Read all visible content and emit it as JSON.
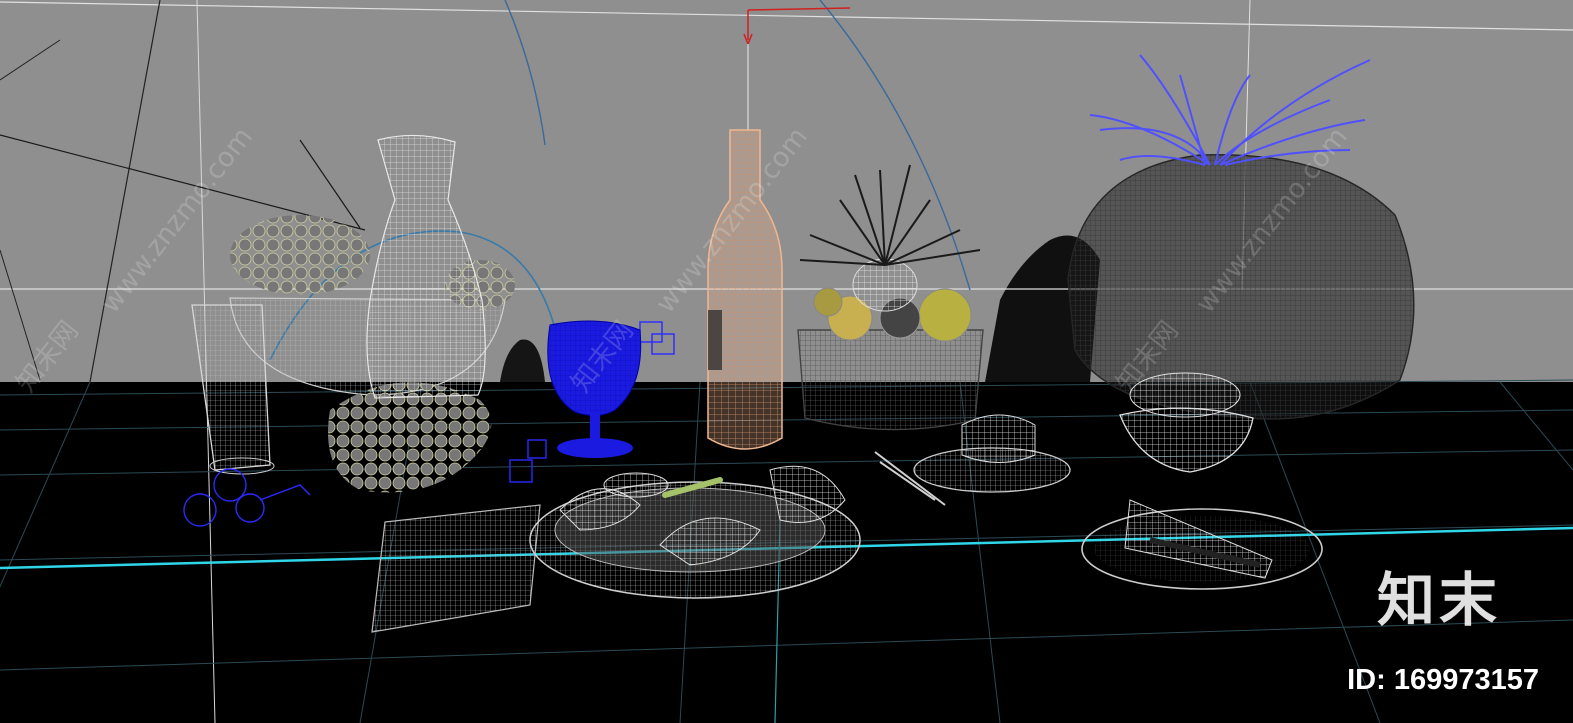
{
  "viewport": {
    "background_top": "#8f8f8f",
    "background_floor": "#000000",
    "wire_white": "#e6e6e6",
    "wire_grey": "#a8a8a8",
    "wire_dark": "#3a3a3a",
    "selected_blue": "#1a1ae0",
    "bottle_peach": "#f0b890",
    "grass_blue": "#5050ff",
    "grid_cyan": "#2fd6e8",
    "gizmo_red": "#d02020"
  },
  "watermarks": {
    "site": "www.znzmo.com",
    "brand_cn": "知末网"
  },
  "branding": {
    "logo_text": "知末",
    "asset_id": "ID: 169973157"
  },
  "objects": [
    {
      "name": "carafe",
      "icon": "carafe-wireframe"
    },
    {
      "name": "grape-bowl",
      "icon": "bowl-wireframe"
    },
    {
      "name": "tall-glass",
      "icon": "glass-wireframe"
    },
    {
      "name": "brandy-glass",
      "icon": "snifter-selected"
    },
    {
      "name": "wine-bottle",
      "icon": "bottle-wireframe"
    },
    {
      "name": "fruit-basket",
      "icon": "basket-wireframe"
    },
    {
      "name": "wicker-pot",
      "icon": "pot-wireframe"
    },
    {
      "name": "grass-plant",
      "icon": "plant-selected"
    },
    {
      "name": "cake-plate",
      "icon": "plate-wireframe"
    },
    {
      "name": "dessert-bowl",
      "icon": "bowl-wireframe"
    },
    {
      "name": "food-platter",
      "icon": "platter-wireframe"
    },
    {
      "name": "napkin",
      "icon": "cloth-wireframe"
    }
  ]
}
